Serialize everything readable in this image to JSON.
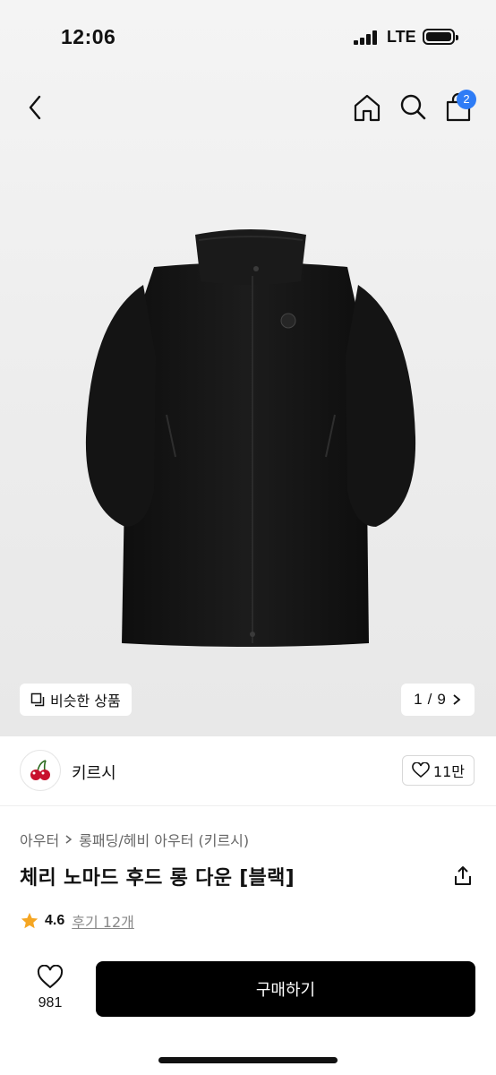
{
  "status": {
    "time": "12:06",
    "network": "LTE"
  },
  "nav": {
    "cart_count": "2"
  },
  "image": {
    "similar_label": "비슷한 상품",
    "page_current": "1",
    "page_total": "9",
    "page_separator": "/"
  },
  "brand": {
    "name": "키르시",
    "likes": "11만"
  },
  "breadcrumb": {
    "level1": "아우터",
    "level2": "롱패딩/헤비 아우터 (키르시)"
  },
  "product": {
    "title": "체리 노마드 후드 롱 다운 [블랙]"
  },
  "rating": {
    "score": "4.6",
    "reviews": "후기 12개"
  },
  "bottom": {
    "wish_count": "981",
    "buy_label": "구매하기"
  },
  "colors": {
    "accent_badge": "#2e7cf6",
    "buy_button": "#000000",
    "star": "#f5a623",
    "cherry": "#c8102e"
  }
}
